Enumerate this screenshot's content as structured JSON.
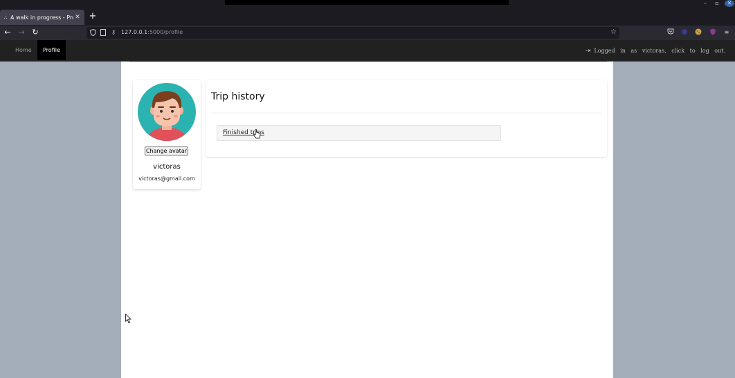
{
  "browser": {
    "tab_title": "A walk in progress - Profile",
    "url_host": "127.0.0.1",
    "url_rest": ":5000/profile"
  },
  "app": {
    "nav": {
      "home": "Home",
      "profile": "Profile"
    },
    "logout_text": "Logged in as victoras, click to log out."
  },
  "profile": {
    "change_avatar_label": "Change avatar",
    "username": "victoras",
    "email": "victoras@gmail.com"
  },
  "history": {
    "title": "Trip history",
    "finished_trips_label": "Finished trips"
  }
}
